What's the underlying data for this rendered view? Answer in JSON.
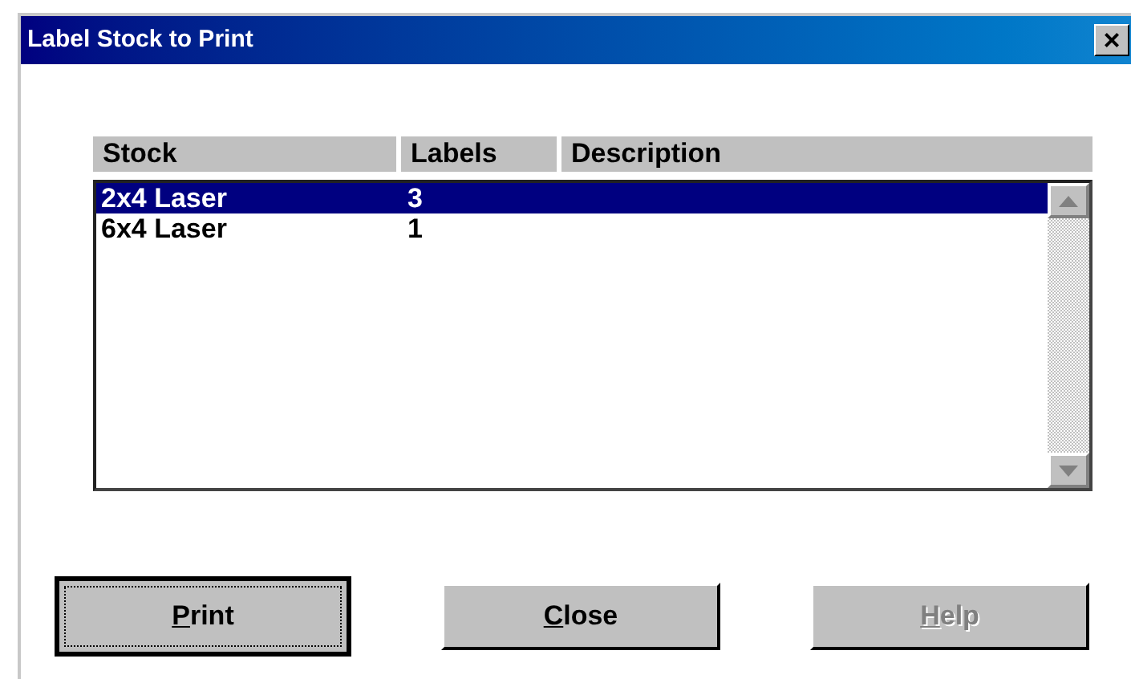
{
  "window": {
    "title": "Label Stock to Print",
    "close_glyph": "×"
  },
  "table": {
    "columns": [
      "Stock",
      "Labels",
      "Description"
    ],
    "rows": [
      {
        "stock": "2x4 Laser",
        "labels": "3",
        "selected": true
      },
      {
        "stock": "6x4 Laser",
        "labels": "1",
        "selected": false
      }
    ]
  },
  "buttons": [
    {
      "label": "Print",
      "default": true,
      "disabled": false
    },
    {
      "label": "Close",
      "default": false,
      "disabled": false
    },
    {
      "label": "Help",
      "default": false,
      "disabled": true
    }
  ]
}
